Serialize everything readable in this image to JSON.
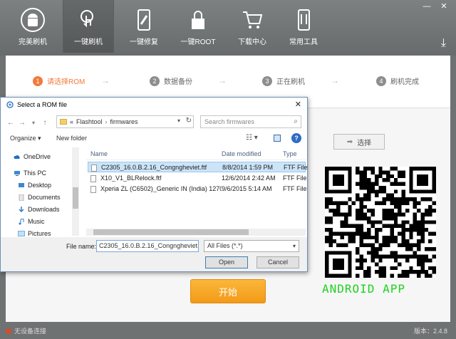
{
  "app": {
    "tabs": [
      {
        "label": "完美刷机",
        "icon": "android-logo-icon"
      },
      {
        "label": "一键刷机",
        "icon": "touch-icon"
      },
      {
        "label": "一键修复",
        "icon": "wrench-phone-icon"
      },
      {
        "label": "一键ROOT",
        "icon": "lock-icon"
      },
      {
        "label": "下载中心",
        "icon": "cart-icon"
      },
      {
        "label": "常用工具",
        "icon": "tools-phone-icon"
      }
    ],
    "window_controls": {
      "minimize": "—",
      "close": "✕"
    },
    "steps": [
      {
        "num": "1",
        "label": "请选择ROM"
      },
      {
        "num": "2",
        "label": "数据备份"
      },
      {
        "num": "3",
        "label": "正在刷机"
      },
      {
        "num": "4",
        "label": "刷机完成"
      }
    ],
    "select_button": "选择",
    "start_button": "开始",
    "android_app": "ANDROID APP",
    "status_left": "无设备连接",
    "version": "版本：2.4.8",
    "accent": "#f07b3b"
  },
  "dialog": {
    "title": "Select a ROM file",
    "breadcrumb": {
      "prefix": "«",
      "parts": [
        "Flashtool",
        "firmwares"
      ]
    },
    "search_placeholder": "Search firmwares",
    "toolbar": {
      "organize": "Organize ▾",
      "new_folder": "New folder"
    },
    "nav": [
      {
        "label": "OneDrive",
        "icon": "cloud-icon"
      },
      {
        "label": "This PC",
        "icon": "computer-icon"
      },
      {
        "label": "Desktop",
        "icon": "desktop-icon"
      },
      {
        "label": "Documents",
        "icon": "documents-icon"
      },
      {
        "label": "Downloads",
        "icon": "downloads-icon"
      },
      {
        "label": "Music",
        "icon": "music-icon"
      },
      {
        "label": "Pictures",
        "icon": "pictures-icon"
      }
    ],
    "columns": {
      "name": "Name",
      "date": "Date modified",
      "type": "Type"
    },
    "files": [
      {
        "name": "C2305_16.0.B.2.16_Congngheviet.ftf",
        "date": "8/8/2014 1:59 PM",
        "type": "FTF File",
        "selected": true
      },
      {
        "name": "X10_V1_BLRelock.ftf",
        "date": "12/6/2014 2:42 AM",
        "type": "FTF File",
        "selected": false
      },
      {
        "name": "Xperia ZL (C6502)_Generic IN (India) 1270...",
        "date": "9/6/2015 5:14 AM",
        "type": "FTF File",
        "selected": false
      }
    ],
    "file_name_label": "File name:",
    "file_name_value": "C2305_16.0.B.2.16_Congngheviet.f",
    "file_type": "All Files (*.*)",
    "open_button": "Open",
    "cancel_button": "Cancel"
  }
}
